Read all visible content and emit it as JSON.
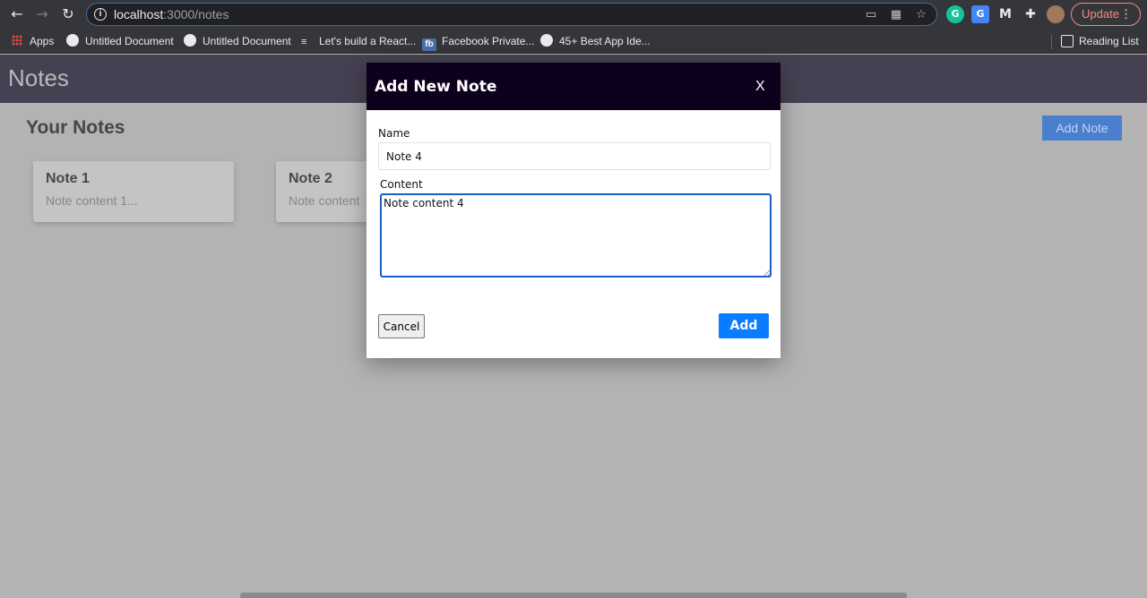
{
  "browser": {
    "url_host": "localhost",
    "url_path": ":3000/notes",
    "update_label": "Update",
    "bookmarks": {
      "apps": "Apps",
      "b1": "Untitled Document",
      "b2": "Untitled Document",
      "b3": "Let's build a React...",
      "b4": "Facebook Private...",
      "b5": "45+ Best App Ide...",
      "reading_list": "Reading List"
    },
    "fb_icon_text": "fb"
  },
  "app": {
    "title": "Notes",
    "section_title": "Your Notes",
    "add_note_label": "Add Note",
    "notes": [
      {
        "title": "Note 1",
        "content": "Note content 1..."
      },
      {
        "title": "Note 2",
        "content": "Note content"
      }
    ]
  },
  "modal": {
    "title": "Add New Note",
    "close_label": "X",
    "name_label": "Name",
    "name_value": "Note 4",
    "content_label": "Content",
    "content_value": "Note content 4",
    "cancel_label": "Cancel",
    "add_label": "Add"
  },
  "icons": {
    "back": "back-arrow-icon",
    "forward": "forward-arrow-icon",
    "reload": "reload-icon",
    "info": "info-icon",
    "cast": "cast-icon",
    "qr": "qr-code-icon",
    "star": "star-icon",
    "extensions": "puzzle-icon"
  },
  "colors": {
    "modal_header": "#0e001c",
    "primary_button": "#0a7cff",
    "focus_ring": "#1a5fc4",
    "app_header": "#464152",
    "overlay_bg": "#b3b3b3"
  }
}
